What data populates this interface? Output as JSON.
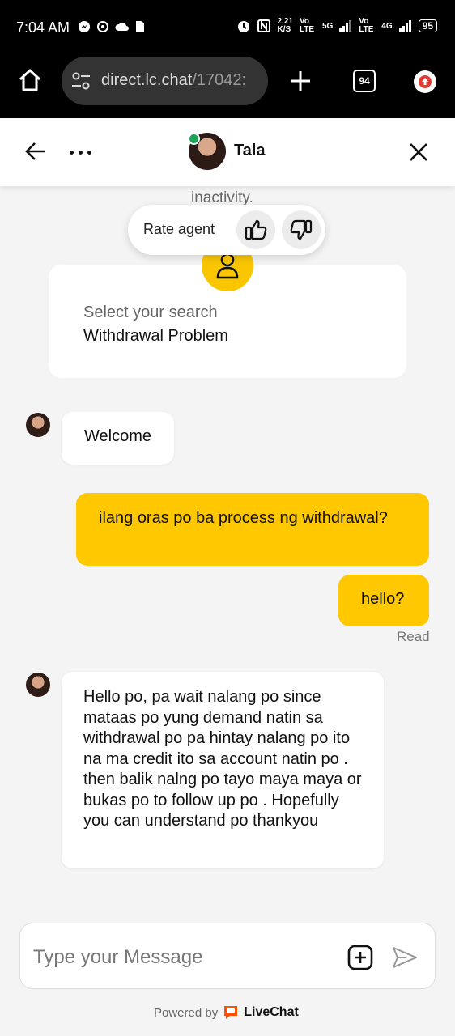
{
  "status_bar": {
    "time": "7:04 AM",
    "net_speed": "2.21",
    "net_unit": "K/S",
    "network_1": "Vo LTE",
    "network_2": "5G",
    "network_3": "Vo LTE",
    "network_4": "4G",
    "battery": "95"
  },
  "browser": {
    "url_domain": "direct.lc.chat",
    "url_path": "/17042:",
    "tab_count": "94"
  },
  "header": {
    "agent_name": "Tala"
  },
  "chat": {
    "behind_text": "inactivity.",
    "rate_label": "Rate agent",
    "search_card": {
      "label": "Select your search",
      "value": "Withdrawal Problem"
    },
    "messages": [
      {
        "from": "agent",
        "text": "Welcome"
      },
      {
        "from": "user",
        "text": "ilang oras po ba process ng withdrawal?"
      },
      {
        "from": "user",
        "text": "hello?"
      },
      {
        "from": "agent",
        "text": "Hello po, pa wait nalang po since mataas po yung demand natin sa withdrawal po pa hintay nalang po ito na ma credit ito sa account natin po . then balik nalng po tayo maya maya or bukas po to follow up po . Hopefully you can understand po thankyou"
      }
    ],
    "read_status": "Read"
  },
  "composer": {
    "placeholder": "Type your Message"
  },
  "footer": {
    "powered_by": "Powered by",
    "brand": "LiveChat"
  },
  "colors": {
    "accent": "#ffc800",
    "online": "#1ba55a",
    "brand": "#ff5100"
  }
}
